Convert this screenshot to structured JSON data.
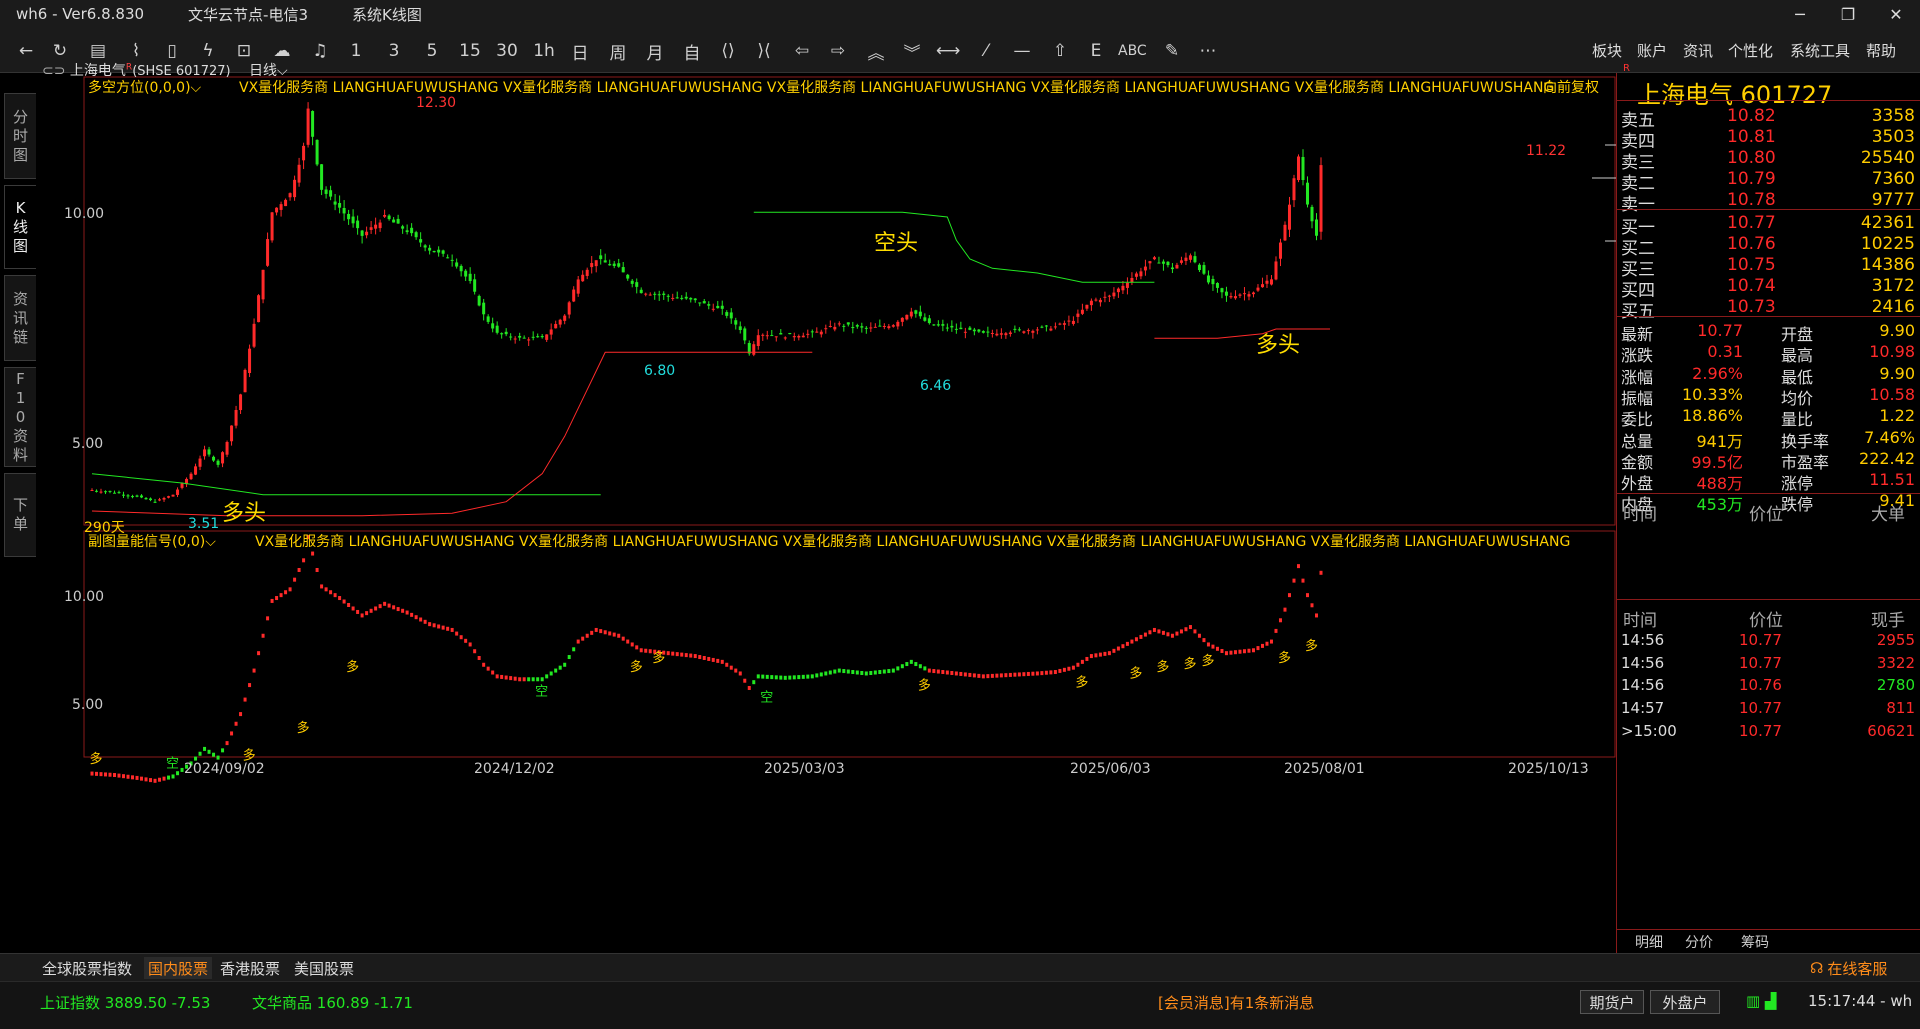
{
  "title": {
    "app": "wh6",
    "version": "Ver6.8.830",
    "server": "文华云节点-电信3",
    "view": "系统K线图"
  },
  "toolbar": {
    "periods": [
      "1",
      "3",
      "5",
      "15",
      "30",
      "1h",
      "日",
      "周",
      "月",
      "自"
    ],
    "abc": "ABC",
    "menus": [
      "板块",
      "账户",
      "资讯",
      "个性化",
      "系统工具",
      "帮助"
    ]
  },
  "left_tabs": [
    "分时图",
    "K线图",
    "资讯链",
    "F10资料",
    "下单"
  ],
  "chart_header": {
    "name": "上海电气",
    "super": "R",
    "code": "(SHSE 601727)",
    "period": "日线",
    "main_indicator": "多空方位(0,0,0)",
    "sub_indicator": "副图量能信号(0,0)",
    "watermark": "VX量化服务商  LIANGHUAFUWUSHANG  VX量化服务商  LIANGHUAFUWUSHANG  VX量化服务商  LIANGHUAFUWUSHANG  VX量化服务商  LIANGHUAFUWUSHANG  VX量化服务商  LIANGHUAFUWUSHANG",
    "adjust": "向前复权",
    "days": "290天"
  },
  "chart_data": {
    "type": "candlestick",
    "ylim_main": [
      3.1,
      12.7
    ],
    "ylim_sub": [
      4.2,
      11.6
    ],
    "yticks_main": [
      "10.00",
      "5.00"
    ],
    "yticks_sub": [
      "10.00",
      "5.00"
    ],
    "xticks": [
      "2024/09/02",
      "2024/12/02",
      "2025/03/03",
      "2025/06/03",
      "2025/08/01",
      "2025/10/13"
    ],
    "price_labels": {
      "high": "12.30",
      "low1": "3.51",
      "low2": "6.80",
      "low3": "6.46",
      "recent_high": "11.22"
    },
    "annotations": [
      "多头",
      "空头",
      "多头"
    ],
    "signals": {
      "long": "多",
      "short": "空"
    },
    "anchors": [
      [
        0,
        3.85
      ],
      [
        5,
        3.8
      ],
      [
        10,
        3.7
      ],
      [
        14,
        3.6
      ],
      [
        18,
        3.75
      ],
      [
        22,
        4.2
      ],
      [
        25,
        4.7
      ],
      [
        28,
        4.4
      ],
      [
        30,
        4.9
      ],
      [
        33,
        5.9
      ],
      [
        36,
        7.4
      ],
      [
        40,
        9.8
      ],
      [
        44,
        10.2
      ],
      [
        47,
        11.2
      ],
      [
        48,
        12.0
      ],
      [
        51,
        10.3
      ],
      [
        55,
        9.9
      ],
      [
        60,
        9.3
      ],
      [
        65,
        9.7
      ],
      [
        70,
        9.4
      ],
      [
        75,
        9.0
      ],
      [
        80,
        8.8
      ],
      [
        84,
        8.3
      ],
      [
        87,
        7.6
      ],
      [
        90,
        7.2
      ],
      [
        95,
        7.1
      ],
      [
        100,
        7.1
      ],
      [
        105,
        7.6
      ],
      [
        108,
        8.4
      ],
      [
        112,
        8.8
      ],
      [
        117,
        8.6
      ],
      [
        122,
        8.1
      ],
      [
        128,
        8.0
      ],
      [
        134,
        7.9
      ],
      [
        140,
        7.7
      ],
      [
        144,
        7.3
      ],
      [
        146,
        6.8
      ],
      [
        148,
        7.2
      ],
      [
        154,
        7.15
      ],
      [
        160,
        7.2
      ],
      [
        166,
        7.4
      ],
      [
        172,
        7.3
      ],
      [
        178,
        7.4
      ],
      [
        182,
        7.7
      ],
      [
        186,
        7.4
      ],
      [
        192,
        7.3
      ],
      [
        198,
        7.2
      ],
      [
        204,
        7.25
      ],
      [
        210,
        7.3
      ],
      [
        214,
        7.35
      ],
      [
        218,
        7.5
      ],
      [
        222,
        7.9
      ],
      [
        226,
        8.0
      ],
      [
        231,
        8.4
      ],
      [
        236,
        8.8
      ],
      [
        240,
        8.6
      ],
      [
        244,
        8.9
      ],
      [
        248,
        8.3
      ],
      [
        252,
        8.0
      ],
      [
        258,
        8.1
      ],
      [
        262,
        8.4
      ],
      [
        265,
        9.5
      ],
      [
        268,
        11.0
      ],
      [
        270,
        10.0
      ],
      [
        272,
        9.3
      ],
      [
        273,
        10.77
      ]
    ],
    "upper_line": [
      [
        0,
        4.2
      ],
      [
        20,
        4.0
      ],
      [
        38,
        3.75
      ],
      [
        48,
        3.75
      ],
      [
        60,
        3.75
      ],
      [
        70,
        3.75
      ],
      [
        80,
        3.75
      ],
      [
        90,
        3.75
      ],
      [
        100,
        3.75
      ],
      [
        108,
        3.75
      ],
      [
        113,
        3.75
      ]
    ],
    "lower_line": [
      [
        0,
        3.4
      ],
      [
        30,
        3.3
      ],
      [
        60,
        3.3
      ],
      [
        80,
        3.35
      ],
      [
        92,
        3.6
      ],
      [
        100,
        4.2
      ],
      [
        105,
        5.0
      ],
      [
        110,
        6.0
      ],
      [
        114,
        6.8
      ],
      [
        120,
        6.8
      ],
      [
        160,
        6.8
      ]
    ],
    "upper_line2": [
      [
        147,
        9.8
      ],
      [
        160,
        9.8
      ],
      [
        180,
        9.8
      ],
      [
        190,
        9.7
      ],
      [
        192,
        9.2
      ],
      [
        195,
        8.8
      ],
      [
        200,
        8.6
      ],
      [
        210,
        8.5
      ],
      [
        220,
        8.3
      ],
      [
        232,
        8.3
      ],
      [
        236,
        8.3
      ]
    ],
    "lower_line2": [
      [
        236,
        7.1
      ],
      [
        250,
        7.1
      ],
      [
        260,
        7.2
      ],
      [
        263,
        7.3
      ],
      [
        270,
        7.3
      ],
      [
        275,
        7.3
      ]
    ],
    "sub_signal_marks": [
      {
        "i": 1,
        "t": "多",
        "v": 4.6
      },
      {
        "i": 18,
        "t": "空",
        "v": 4.45
      },
      {
        "i": 35,
        "t": "多",
        "v": 4.7
      },
      {
        "i": 47,
        "t": "多",
        "v": 5.6
      },
      {
        "i": 58,
        "t": "多",
        "v": 7.6
      },
      {
        "i": 100,
        "t": "空",
        "v": 6.8
      },
      {
        "i": 121,
        "t": "多",
        "v": 7.6
      },
      {
        "i": 126,
        "t": "多",
        "v": 7.9
      },
      {
        "i": 150,
        "t": "空",
        "v": 6.6
      },
      {
        "i": 185,
        "t": "多",
        "v": 7.0
      },
      {
        "i": 220,
        "t": "多",
        "v": 7.1
      },
      {
        "i": 232,
        "t": "多",
        "v": 7.4
      },
      {
        "i": 238,
        "t": "多",
        "v": 7.6
      },
      {
        "i": 244,
        "t": "多",
        "v": 7.7
      },
      {
        "i": 248,
        "t": "多",
        "v": 7.8
      },
      {
        "i": 265,
        "t": "多",
        "v": 7.9
      },
      {
        "i": 271,
        "t": "多",
        "v": 8.3
      }
    ]
  },
  "panel": {
    "name": "上海电气",
    "code": "601727",
    "r_mark": "R",
    "sell": [
      {
        "label": "卖五",
        "price": "10.82",
        "vol": "3358"
      },
      {
        "label": "卖四",
        "price": "10.81",
        "vol": "3503"
      },
      {
        "label": "卖三",
        "price": "10.80",
        "vol": "25540"
      },
      {
        "label": "卖二",
        "price": "10.79",
        "vol": "7360"
      },
      {
        "label": "卖一",
        "price": "10.78",
        "vol": "9777"
      }
    ],
    "buy": [
      {
        "label": "买一",
        "price": "10.77",
        "vol": "42361"
      },
      {
        "label": "买二",
        "price": "10.76",
        "vol": "10225"
      },
      {
        "label": "买三",
        "price": "10.75",
        "vol": "14386"
      },
      {
        "label": "买四",
        "price": "10.74",
        "vol": "3172"
      },
      {
        "label": "买五",
        "price": "10.73",
        "vol": "2416"
      }
    ],
    "stats": [
      {
        "l1": "最新",
        "v1": "10.77",
        "c1": "red",
        "l2": "开盘",
        "v2": "9.90",
        "c2": "yellow"
      },
      {
        "l1": "涨跌",
        "v1": "0.31",
        "c1": "red",
        "l2": "最高",
        "v2": "10.98",
        "c2": "red"
      },
      {
        "l1": "涨幅",
        "v1": "2.96%",
        "c1": "red",
        "l2": "最低",
        "v2": "9.90",
        "c2": "yellow"
      },
      {
        "l1": "振幅",
        "v1": "10.33%",
        "c1": "yellow",
        "l2": "均价",
        "v2": "10.58",
        "c2": "red"
      },
      {
        "l1": "委比",
        "v1": "18.86%",
        "c1": "yellow",
        "l2": "量比",
        "v2": "1.22",
        "c2": "yellow"
      },
      {
        "l1": "总量",
        "v1": "941万",
        "c1": "yellow",
        "l2": "换手率",
        "v2": "7.46%",
        "c2": "yellow"
      },
      {
        "l1": "金额",
        "v1": "99.5亿",
        "c1": "red",
        "l2": "市盈率",
        "v2": "222.42",
        "c2": "yellow"
      },
      {
        "l1": "外盘",
        "v1": "488万",
        "c1": "red",
        "l2": "涨停",
        "v2": "11.51",
        "c2": "red"
      },
      {
        "l1": "内盘",
        "v1": "453万",
        "c1": "green",
        "l2": "跌停",
        "v2": "9.41",
        "c2": "yellow"
      }
    ],
    "tick_header1": {
      "time": "时间",
      "price": "价位",
      "big": "大单"
    },
    "tick_header2": {
      "time": "时间",
      "price": "价位",
      "vol": "现手"
    },
    "ticks": [
      {
        "time": "14:56",
        "price": "10.77",
        "vol": "2955",
        "pc": "red",
        "vc": "red"
      },
      {
        "time": "14:56",
        "price": "10.77",
        "vol": "3322",
        "pc": "red",
        "vc": "red"
      },
      {
        "time": "14:56",
        "price": "10.76",
        "vol": "2780",
        "pc": "red",
        "vc": "green"
      },
      {
        "time": "14:57",
        "price": "10.77",
        "vol": "811",
        "pc": "red",
        "vc": "red"
      },
      {
        "time": ">15:00",
        "price": "10.77",
        "vol": "60621",
        "pc": "red",
        "vc": "red"
      }
    ],
    "bottom_tabs": [
      "明细",
      "分价",
      "筹码"
    ]
  },
  "market_tabs": [
    "全球股票指数",
    "国内股票",
    "香港股票",
    "美国股票"
  ],
  "active_market": 1,
  "service": "在线客服",
  "status": {
    "idx1_name": "上证指数",
    "idx1_val": "3889.50",
    "idx1_chg": "-7.53",
    "idx2_name": "文华商品",
    "idx2_val": "160.89",
    "idx2_chg": "-1.71",
    "message": "[会员消息]有1条新消息",
    "btn1": "期货户",
    "btn2": "外盘户",
    "clock": "15:17:44 - wh"
  },
  "colors": {
    "up": "#ff2a2a",
    "down": "#22e822",
    "accent": "#ffcc00",
    "cyan": "#22dddd",
    "frame": "#8a1a1a"
  }
}
